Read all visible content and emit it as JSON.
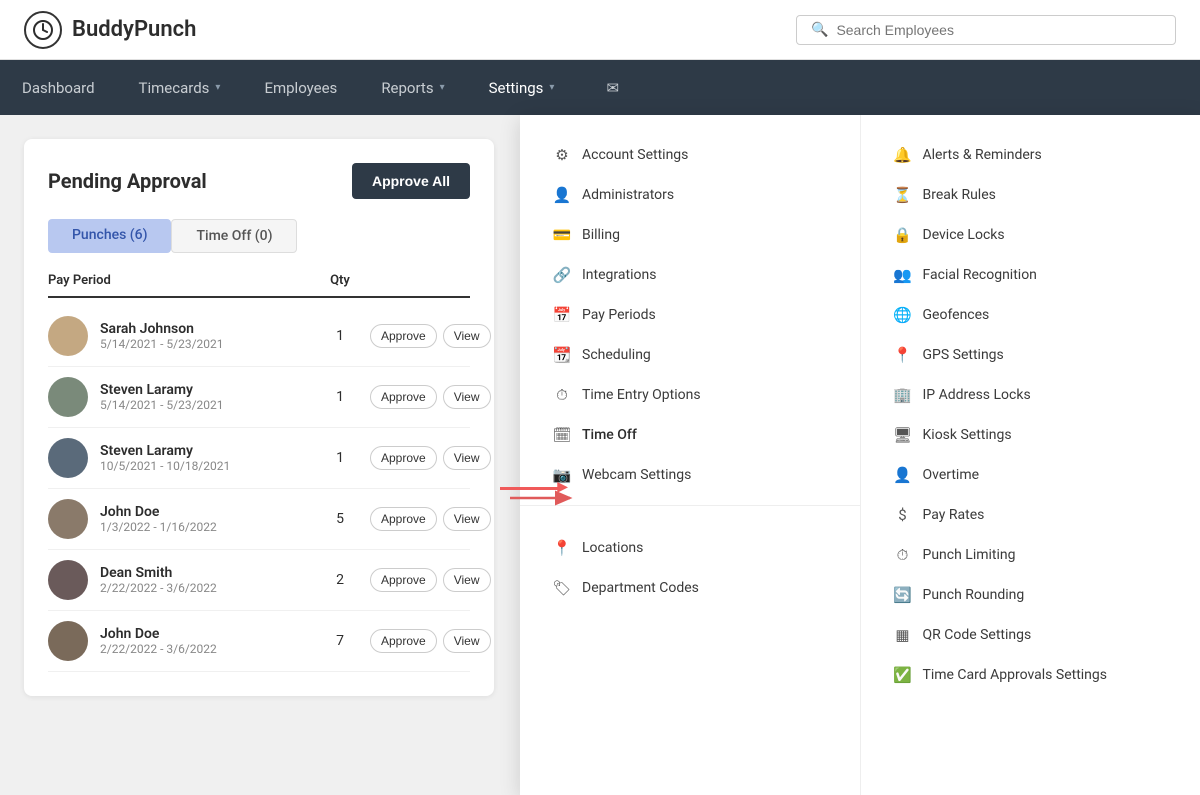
{
  "header": {
    "logo_text": "BuddyPunch",
    "search_placeholder": "Search Employees"
  },
  "nav": {
    "items": [
      {
        "label": "Dashboard",
        "has_chevron": false
      },
      {
        "label": "Timecards",
        "has_chevron": true
      },
      {
        "label": "Employees",
        "has_chevron": false
      },
      {
        "label": "Reports",
        "has_chevron": true
      },
      {
        "label": "Settings",
        "has_chevron": true
      }
    ],
    "mail_label": "✉"
  },
  "card": {
    "title": "Pending Approval",
    "approve_all_label": "Approve All",
    "tabs": [
      {
        "label": "Punches (6)",
        "active": true
      },
      {
        "label": "Time Off (0)",
        "active": false
      }
    ],
    "table_headers": {
      "pay_period": "Pay Period",
      "qty": "Qty"
    },
    "rows": [
      {
        "name": "Sarah Johnson",
        "period": "5/14/2021 - 5/23/2021",
        "qty": 1,
        "avatar_class": "av1"
      },
      {
        "name": "Steven Laramy",
        "period": "5/14/2021 - 5/23/2021",
        "qty": 1,
        "avatar_class": "av2"
      },
      {
        "name": "Steven Laramy",
        "period": "10/5/2021 - 10/18/2021",
        "qty": 1,
        "avatar_class": "av3"
      },
      {
        "name": "John Doe",
        "period": "1/3/2022 - 1/16/2022",
        "qty": 5,
        "avatar_class": "av4"
      },
      {
        "name": "Dean Smith",
        "period": "2/22/2022 - 3/6/2022",
        "qty": 2,
        "avatar_class": "av5"
      },
      {
        "name": "John Doe",
        "period": "2/22/2022 - 3/6/2022",
        "qty": 7,
        "avatar_class": "av6"
      }
    ],
    "approve_label": "Approve",
    "view_label": "View"
  },
  "dropdown": {
    "col1": {
      "items": [
        {
          "label": "Account Settings",
          "icon": "⚙"
        },
        {
          "label": "Administrators",
          "icon": "👤"
        },
        {
          "label": "Billing",
          "icon": "💳"
        },
        {
          "label": "Integrations",
          "icon": "🔗"
        },
        {
          "label": "Pay Periods",
          "icon": "📅"
        },
        {
          "label": "Scheduling",
          "icon": "📆"
        },
        {
          "label": "Time Entry Options",
          "icon": "⏱"
        },
        {
          "label": "Time Off",
          "icon": "🗓"
        },
        {
          "label": "Webcam Settings",
          "icon": "📷"
        }
      ],
      "divider_after": 8,
      "items2": [
        {
          "label": "Locations",
          "icon": "📍"
        },
        {
          "label": "Department Codes",
          "icon": "🏷"
        }
      ]
    },
    "col2": {
      "items": [
        {
          "label": "Alerts & Reminders",
          "icon": "🔔"
        },
        {
          "label": "Break Rules",
          "icon": "⏳"
        },
        {
          "label": "Device Locks",
          "icon": "🔒"
        },
        {
          "label": "Facial Recognition",
          "icon": "👥"
        },
        {
          "label": "Geofences",
          "icon": "🌐"
        },
        {
          "label": "GPS Settings",
          "icon": "📍"
        },
        {
          "label": "IP Address Locks",
          "icon": "🏢"
        },
        {
          "label": "Kiosk Settings",
          "icon": "🖥"
        },
        {
          "label": "Overtime",
          "icon": "👤"
        },
        {
          "label": "Pay Rates",
          "icon": "$"
        },
        {
          "label": "Punch Limiting",
          "icon": "⏱"
        },
        {
          "label": "Punch Rounding",
          "icon": "🔄"
        },
        {
          "label": "QR Code Settings",
          "icon": "▦"
        },
        {
          "label": "Time Card Approvals Settings",
          "icon": "✅"
        }
      ]
    }
  }
}
